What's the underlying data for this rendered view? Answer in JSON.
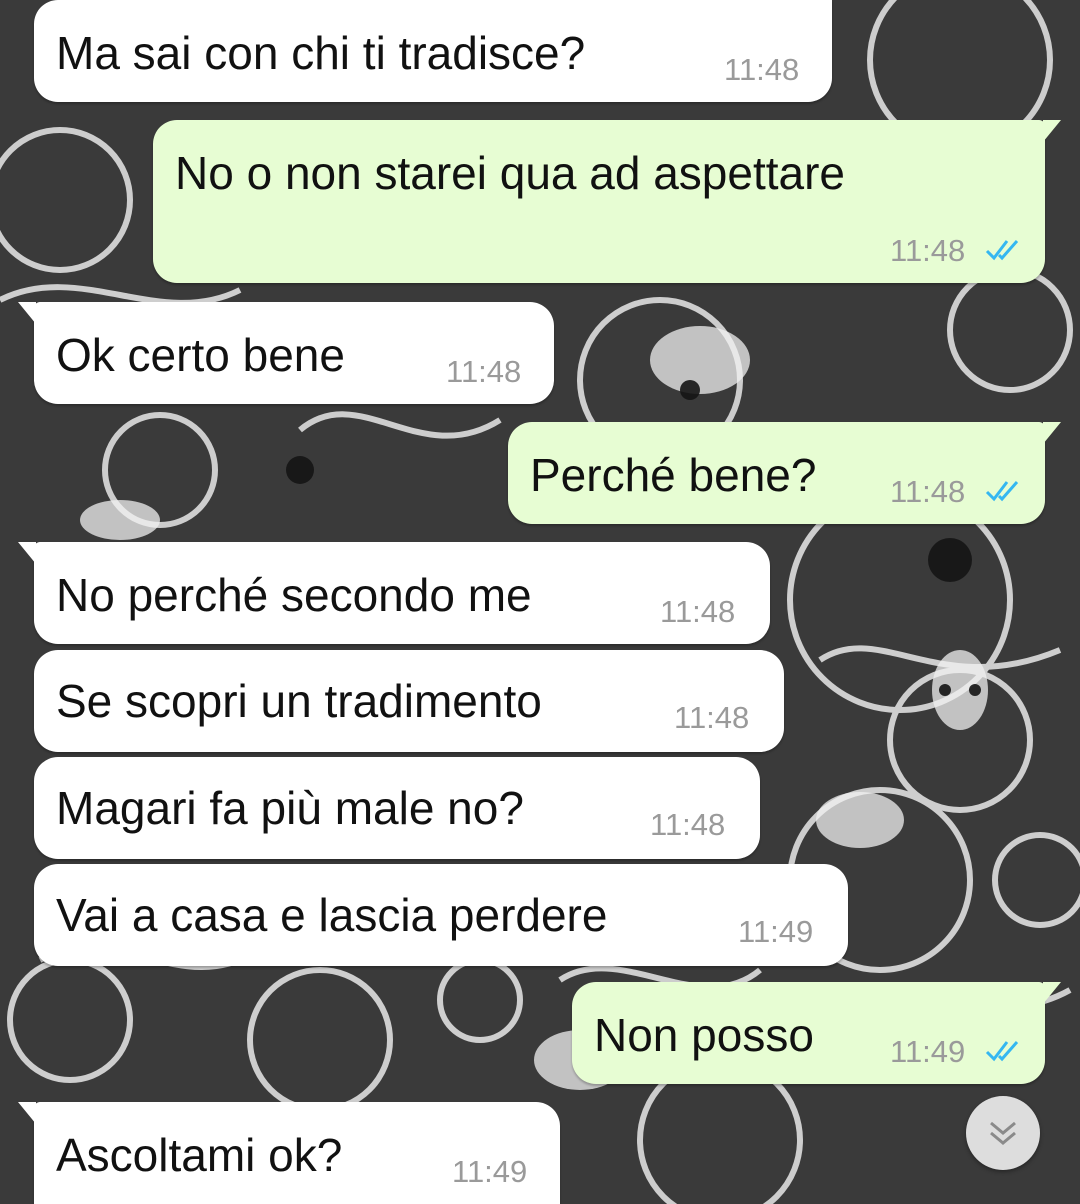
{
  "colors": {
    "incoming_bubble": "#ffffff",
    "outgoing_bubble": "#e7fdd3",
    "timestamp": "#9a9a9a",
    "read_ticks": "#34b7f1"
  },
  "messages": [
    {
      "direction": "incoming",
      "text": "Ma sai con chi ti tradisce?",
      "time": "11:48"
    },
    {
      "direction": "outgoing",
      "text": "No o non starei qua ad aspettare",
      "time": "11:48",
      "status_icon": "double-check-read"
    },
    {
      "direction": "incoming",
      "text": "Ok certo bene",
      "time": "11:48"
    },
    {
      "direction": "outgoing",
      "text": "Perché bene?",
      "time": "11:48",
      "status_icon": "double-check-read"
    },
    {
      "direction": "incoming",
      "text": "No perché secondo me",
      "time": "11:48"
    },
    {
      "direction": "incoming",
      "text": "Se scopri un tradimento",
      "time": "11:48"
    },
    {
      "direction": "incoming",
      "text": "Magari fa più male no?",
      "time": "11:48"
    },
    {
      "direction": "incoming",
      "text": "Vai a casa e lascia perdere",
      "time": "11:49"
    },
    {
      "direction": "outgoing",
      "text": "Non posso",
      "time": "11:49",
      "status_icon": "double-check-read"
    },
    {
      "direction": "incoming",
      "text": "Ascoltami ok?",
      "time": "11:49"
    }
  ],
  "scroll_button": {
    "icon": "double-chevron-down-icon"
  }
}
